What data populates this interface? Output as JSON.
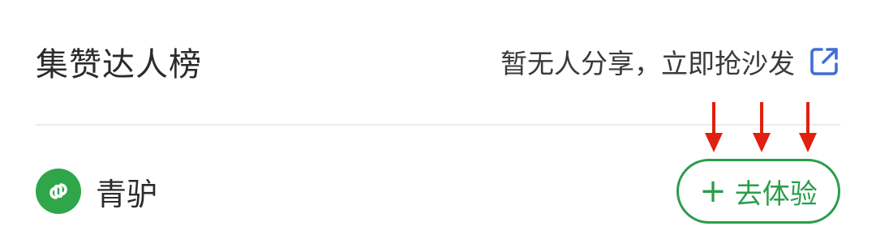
{
  "header": {
    "title": "集赞达人榜",
    "share_text": "暂无人分享，立即抢沙发",
    "share_icon": "external-link-icon"
  },
  "app_item": {
    "name": "青驴",
    "logo_icon": "mini-program-link-icon",
    "button_plus": "+",
    "button_label": "去体验"
  },
  "annotations": {
    "arrow_count": 3,
    "arrow_color": "#e02010"
  },
  "colors": {
    "accent_green": "#2a9d4a",
    "logo_green": "#2fa64a",
    "share_icon_blue": "#3f6fd1",
    "divider": "#ececec",
    "text_dark": "#2b2b2b"
  }
}
